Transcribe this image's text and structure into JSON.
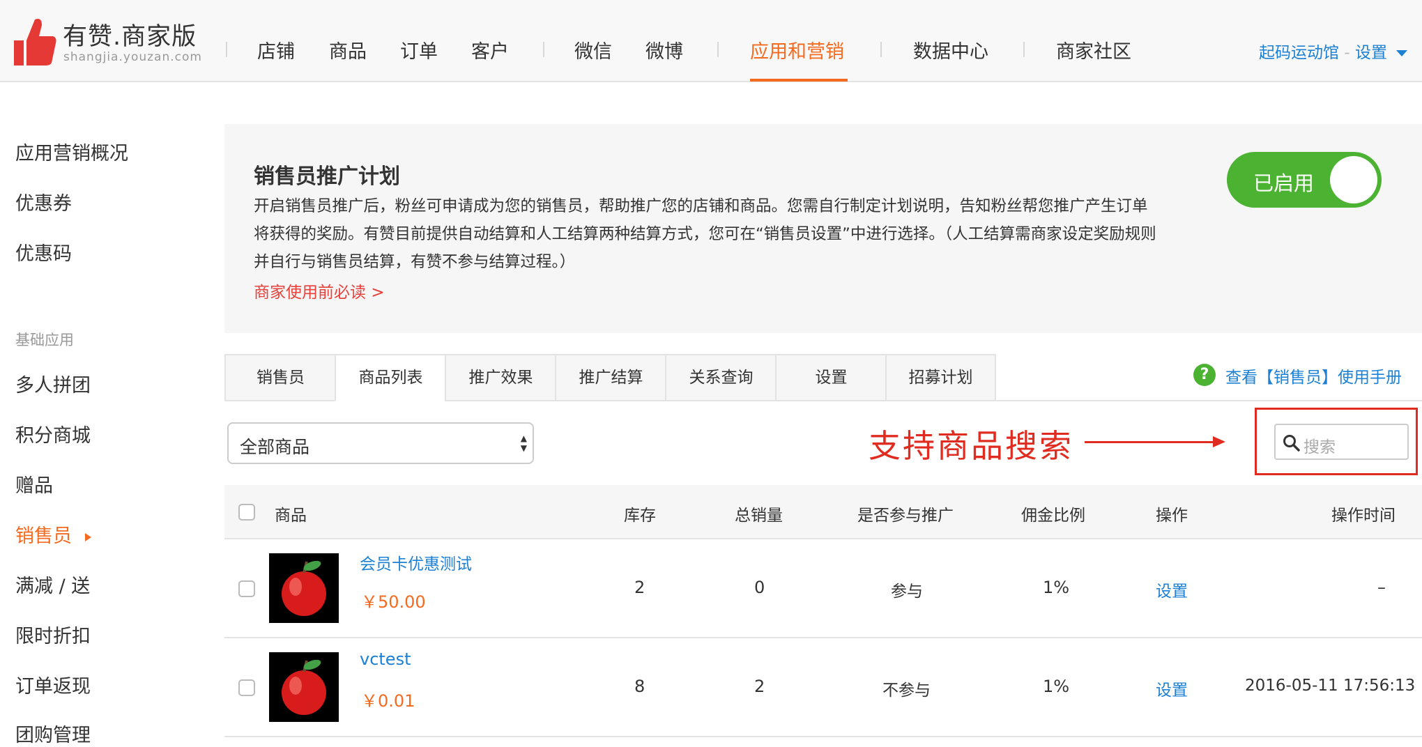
{
  "header": {
    "brand": "有赞.商家版",
    "brand_sub": "shangjia.youzan.com",
    "nav": [
      "店铺",
      "商品",
      "订单",
      "客户",
      "微信",
      "微博",
      "应用和营销",
      "数据中心",
      "商家社区"
    ],
    "account": "起码运动馆",
    "settings": "设置"
  },
  "sidebar": {
    "top_items": [
      "应用营销概况",
      "优惠券",
      "优惠码"
    ],
    "group_title": "基础应用",
    "items": [
      "多人拼团",
      "积分商城",
      "赠品",
      "销售员",
      "满减 / 送",
      "限时折扣",
      "订单返现",
      "团购管理"
    ]
  },
  "intro": {
    "title": "销售员推广计划",
    "description": "开启销售员推广后，粉丝可申请成为您的销售员，帮助推广您的店铺和商品。您需自行制定计划说明，告知粉丝帮您推广产生订单将获得的奖励。有赞目前提供自动结算和人工结算两种结算方式，您可在“销售员设置”中进行选择。（人工结算需商家设定奖励规则并自行与销售员结算，有赞不参与结算过程。）",
    "link": "商家使用前必读 >",
    "toggle_label": "已启用"
  },
  "tabs": [
    "销售员",
    "商品列表",
    "推广效果",
    "推广结算",
    "关系查询",
    "设置",
    "招募计划"
  ],
  "help_link": "查看【销售员】使用手册",
  "filter": {
    "select_value": "全部商品",
    "search_placeholder": "搜索"
  },
  "annotation": "支持商品搜索",
  "table": {
    "headers": [
      "商品",
      "库存",
      "总销量",
      "是否参与推广",
      "佣金比例",
      "操作",
      "操作时间"
    ],
    "rows": [
      {
        "name": "会员卡优惠测试",
        "price": "￥50.00",
        "stock": "2",
        "sales": "0",
        "promo": "参与",
        "commission": "1%",
        "action": "设置",
        "time": "–"
      },
      {
        "name": "vctest",
        "price": "￥0.01",
        "stock": "8",
        "sales": "2",
        "promo": "不参与",
        "commission": "1%",
        "action": "设置",
        "time": "2016-05-11 17:56:13"
      }
    ]
  },
  "colors": {
    "accent": "#f46a1e",
    "link": "#1c80d4",
    "toggle": "#4bb232",
    "annotation": "#e02b20"
  }
}
